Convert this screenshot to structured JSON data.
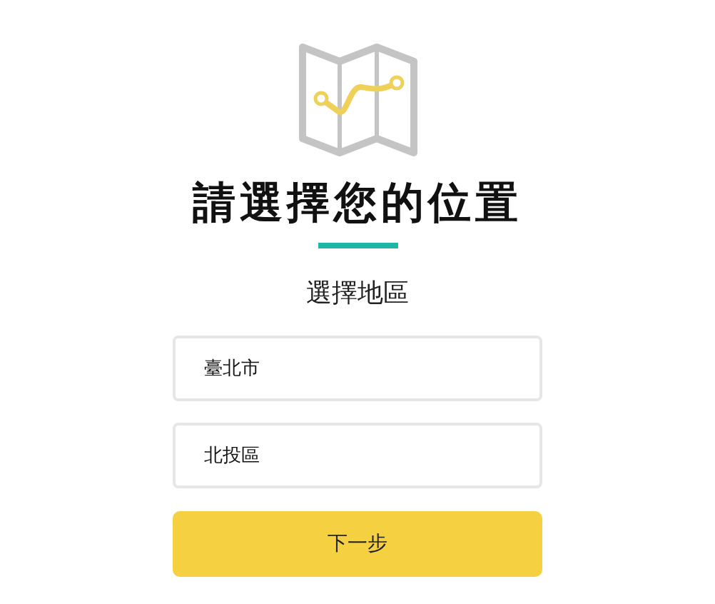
{
  "title": "請選擇您的位置",
  "subtitle": "選擇地區",
  "fields": [
    {
      "value": "臺北市"
    },
    {
      "value": "北投區"
    }
  ],
  "button": "下一步"
}
